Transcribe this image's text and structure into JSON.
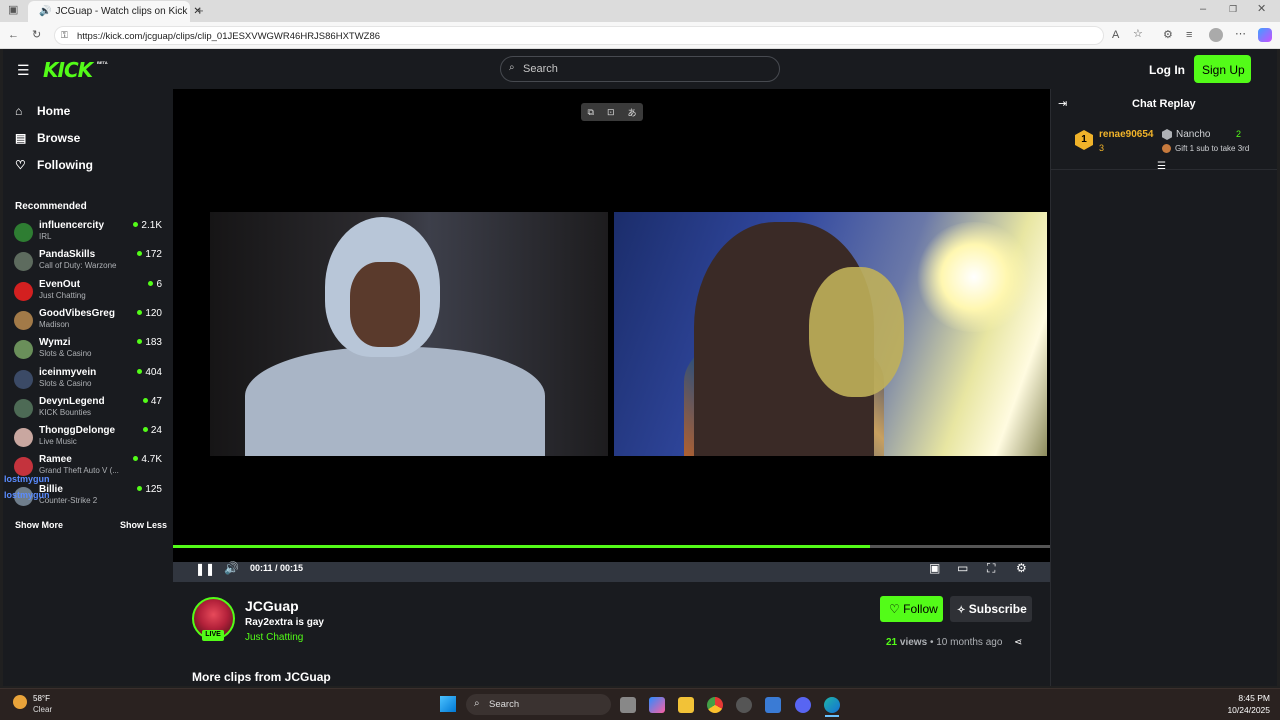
{
  "browser": {
    "tab_title": "JCGuap - Watch clips on Kick",
    "url": "https://kick.com/jcguap/clips/clip_01JESXVWGWR46HRJS86HXTWZ86"
  },
  "header": {
    "logo": "KICK",
    "logo_badge": "BETA",
    "search_placeholder": "Search",
    "login_label": "Log In",
    "signup_label": "Sign Up"
  },
  "sidebar": {
    "nav": [
      {
        "label": "Home",
        "icon": "home-icon"
      },
      {
        "label": "Browse",
        "icon": "browse-icon"
      },
      {
        "label": "Following",
        "icon": "heart-icon"
      }
    ],
    "recommended_title": "Recommended",
    "recommended": [
      {
        "name": "influencercity",
        "category": "IRL",
        "viewers": "2.1K",
        "color": "#2e7d32"
      },
      {
        "name": "PandaSkills",
        "category": "Call of Duty: Warzone",
        "viewers": "172",
        "color": "#5d6b5e"
      },
      {
        "name": "EvenOut",
        "category": "Just Chatting",
        "viewers": "6",
        "color": "#d32020"
      },
      {
        "name": "GoodVibesGreg",
        "category": "Madison",
        "viewers": "120",
        "color": "#a27a48"
      },
      {
        "name": "Wymzi",
        "category": "Slots & Casino",
        "viewers": "183",
        "color": "#6a8f5a"
      },
      {
        "name": "iceinmyvein",
        "category": "Slots & Casino",
        "viewers": "404",
        "color": "#3b4a66"
      },
      {
        "name": "DevynLegend",
        "category": "KICK Bounties",
        "viewers": "47",
        "color": "#4d6a55"
      },
      {
        "name": "ThonggDelonge",
        "category": "Live Music",
        "viewers": "24",
        "color": "#c9a7a0"
      },
      {
        "name": "Ramee",
        "category": "Grand Theft Auto V (...",
        "viewers": "4.7K",
        "color": "#c4333d"
      },
      {
        "name": "Billie",
        "category": "Counter-Strike 2",
        "viewers": "125",
        "color": "#6f7e8c"
      }
    ],
    "show_more": "Show More",
    "show_less": "Show Less",
    "overlay_names": [
      "lostmygun",
      "lostmygun"
    ]
  },
  "player": {
    "time": "00:11 / 00:15",
    "progress": 0.795
  },
  "clip": {
    "channel_name": "JCGuap",
    "title": "Ray2extra is gay",
    "category": "Just Chatting",
    "live_badge": "LIVE",
    "follow_label": "Follow",
    "subscribe_label": "Subscribe",
    "views_count": "21",
    "views_word": "views",
    "age": "• 10 months ago",
    "more_clips": "More clips from JCGuap"
  },
  "chat": {
    "title": "Chat Replay",
    "top_gifters": [
      {
        "rank": "1",
        "name": "renae90654",
        "count": "3"
      },
      {
        "name": "Nancho",
        "count": "2"
      }
    ],
    "gift_prompt": "Gift 1 sub to take 3rd"
  },
  "taskbar": {
    "temperature": "58°F",
    "weather": "Clear",
    "search_placeholder": "Search",
    "time": "8:45 PM",
    "date": "10/24/2025"
  },
  "colors": {
    "accent": "#53fc18",
    "background": "#191b1f",
    "gifter_gold": "#f0b32a"
  }
}
